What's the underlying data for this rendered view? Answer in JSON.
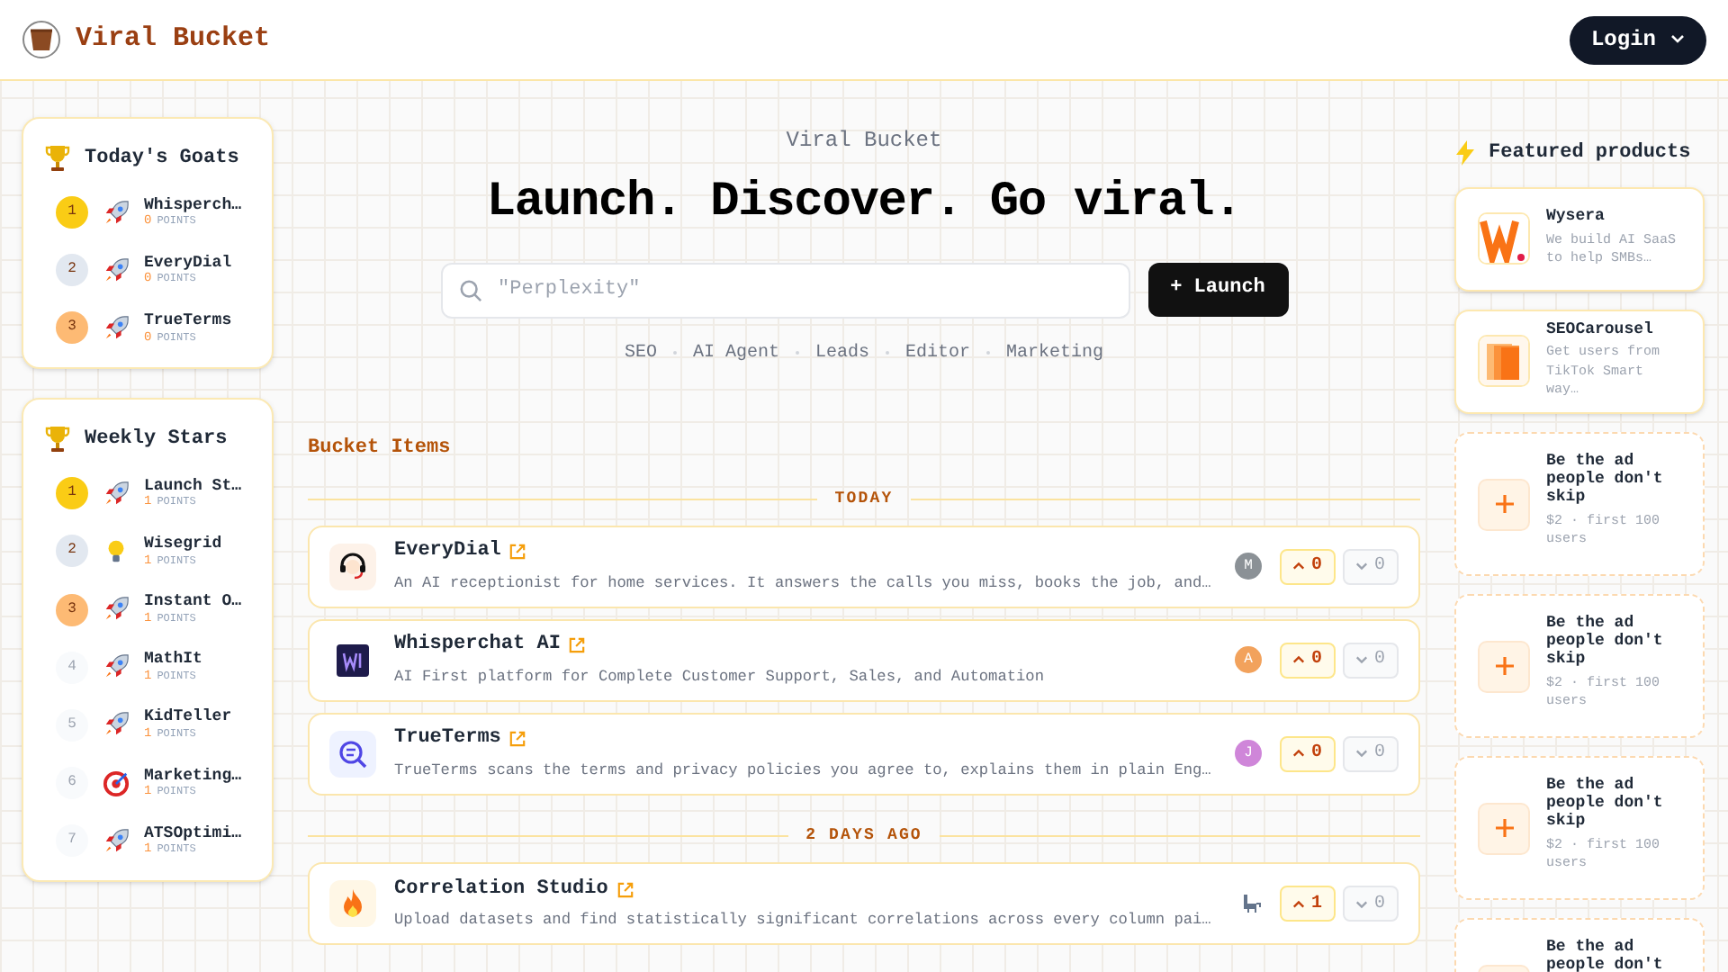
{
  "header": {
    "brand": "Viral Bucket",
    "login": "Login"
  },
  "goats": {
    "title": "Today's Goats",
    "items": [
      {
        "rank": "1",
        "color": "#facc15",
        "kind": "rocket",
        "name": "Whisperch…",
        "points": "0",
        "unit": "POINTS"
      },
      {
        "rank": "2",
        "color": "#e2e8f0",
        "kind": "rocket",
        "name": "EveryDial",
        "points": "0",
        "unit": "POINTS"
      },
      {
        "rank": "3",
        "color": "#fdba74",
        "kind": "rocket",
        "name": "TrueTerms",
        "points": "0",
        "unit": "POINTS"
      }
    ]
  },
  "weekly": {
    "title": "Weekly Stars",
    "items": [
      {
        "rank": "1",
        "color": "#facc15",
        "kind": "rocket",
        "name": "Launch St…",
        "points": "1",
        "unit": "POINTS"
      },
      {
        "rank": "2",
        "color": "#e2e8f0",
        "kind": "bulb",
        "name": "Wisegrid",
        "points": "1",
        "unit": "POINTS"
      },
      {
        "rank": "3",
        "color": "#fdba74",
        "kind": "rocket",
        "name": "Instant O…",
        "points": "1",
        "unit": "POINTS"
      },
      {
        "rank": "4",
        "color": "#f8fafc",
        "kind": "rocket",
        "name": "MathIt",
        "points": "1",
        "unit": "POINTS"
      },
      {
        "rank": "5",
        "color": "#f8fafc",
        "kind": "rocket",
        "name": "KidTeller",
        "points": "1",
        "unit": "POINTS"
      },
      {
        "rank": "6",
        "color": "#f8fafc",
        "kind": "target",
        "name": "Marketing…",
        "points": "1",
        "unit": "POINTS"
      },
      {
        "rank": "7",
        "color": "#f8fafc",
        "kind": "rocket",
        "name": "ATSOptimi…",
        "points": "1",
        "unit": "POINTS"
      }
    ]
  },
  "hero": {
    "eyebrow": "Viral Bucket",
    "headline": "Launch. Discover. Go viral.",
    "search_placeholder": "\"Perplexity\"",
    "launch": "+ Launch",
    "tags": [
      "SEO",
      "AI Agent",
      "Leads",
      "Editor",
      "Marketing"
    ]
  },
  "bucket": {
    "title": "Bucket Items",
    "groups": [
      {
        "label": "TODAY",
        "items": [
          {
            "kind": "headset",
            "name": "EveryDial",
            "description": "An AI receptionist for home services. It answers the calls you miss, books the job, and…",
            "maker": {
              "kind": "letter",
              "text": "M",
              "color": "#8b9196"
            },
            "up": "0",
            "down": "0"
          },
          {
            "kind": "wi",
            "name": "Whisperchat AI",
            "description": "AI First platform for Complete Customer Support, Sales, and Automation",
            "maker": {
              "kind": "letter",
              "text": "A",
              "color": "#f2a25c"
            },
            "up": "0",
            "down": "0"
          },
          {
            "kind": "magnifier",
            "name": "TrueTerms",
            "description": "TrueTerms scans the terms and privacy policies you agree to, explains them in plain Eng…",
            "maker": {
              "kind": "letter",
              "text": "J",
              "color": "#cf86d9"
            },
            "up": "0",
            "down": "0"
          }
        ]
      },
      {
        "label": "2 DAYS AGO",
        "items": [
          {
            "kind": "flame",
            "name": "Correlation Studio",
            "description": "Upload datasets and find statistically significant correlations across every column pai…",
            "maker": {
              "kind": "llama"
            },
            "up": "1",
            "down": "0"
          }
        ]
      }
    ]
  },
  "featured": {
    "title": "Featured products",
    "items": [
      {
        "kind": "product",
        "name": "Wysera",
        "description": "We build AI SaaS to help SMBs…"
      },
      {
        "kind": "product",
        "name": "SEOCarousel",
        "description": "Get users from TikTok Smart way…"
      },
      {
        "kind": "ad",
        "name": "Be the ad people don't skip",
        "description": "$2 · first 100 users"
      },
      {
        "kind": "ad",
        "name": "Be the ad people don't skip",
        "description": "$2 · first 100 users"
      },
      {
        "kind": "ad",
        "name": "Be the ad people don't skip",
        "description": "$2 · first 100 users"
      },
      {
        "kind": "ad",
        "name": "Be the ad people don't"
      }
    ]
  }
}
